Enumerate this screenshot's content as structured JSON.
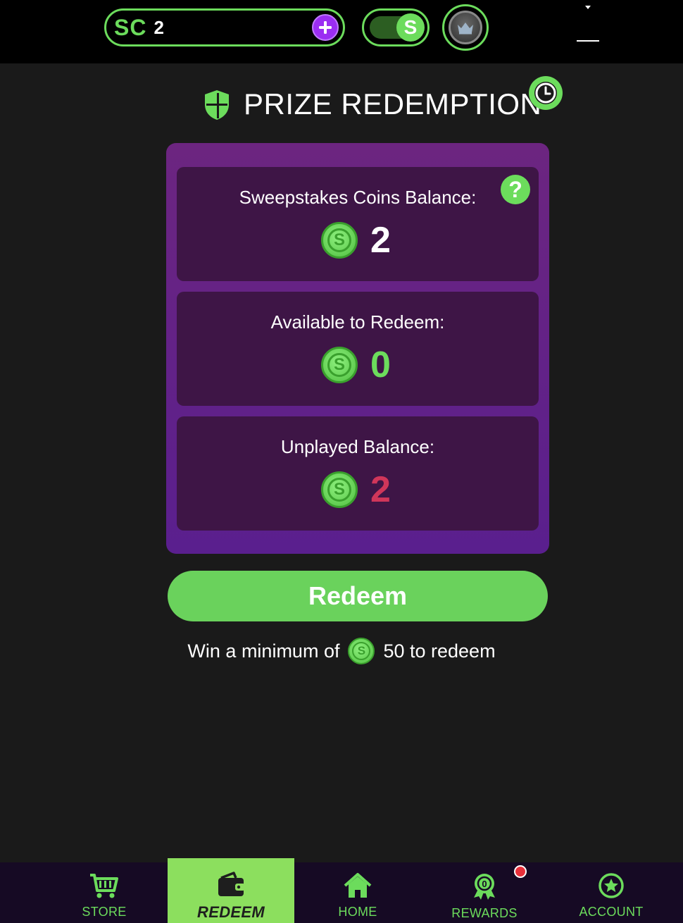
{
  "topbar": {
    "sc_label": "SC",
    "sc_value": "2",
    "toggle_symbol": "S"
  },
  "title": "PRIZE REDEMPTION",
  "panels": [
    {
      "label": "Sweepstakes Coins Balance:",
      "value": "2",
      "value_color": "#ffffff"
    },
    {
      "label": "Available to Redeem:",
      "value": "0",
      "value_color": "#6cdc5c"
    },
    {
      "label": "Unplayed Balance:",
      "value": "2",
      "value_color": "#d0365a"
    }
  ],
  "help_symbol": "?",
  "coin_symbol": "S",
  "redeem_label": "Redeem",
  "min_note": {
    "prefix": "Win a minimum of",
    "suffix": "50 to redeem"
  },
  "nav": [
    {
      "label": "STORE",
      "icon": "cart-icon"
    },
    {
      "label": "REDEEM",
      "icon": "wallet-icon",
      "active": true
    },
    {
      "label": "HOME",
      "icon": "home-icon"
    },
    {
      "label": "REWARDS",
      "icon": "rewards-badge-icon"
    },
    {
      "label": "ACCOUNT",
      "icon": "star-circle-icon"
    }
  ],
  "colors": {
    "accent_green": "#6cdc5c",
    "card_purple": "#6c2580",
    "panel_purple": "#3e1546",
    "plus_purple": "#9b2df2",
    "unplayed_red": "#d0365a"
  }
}
